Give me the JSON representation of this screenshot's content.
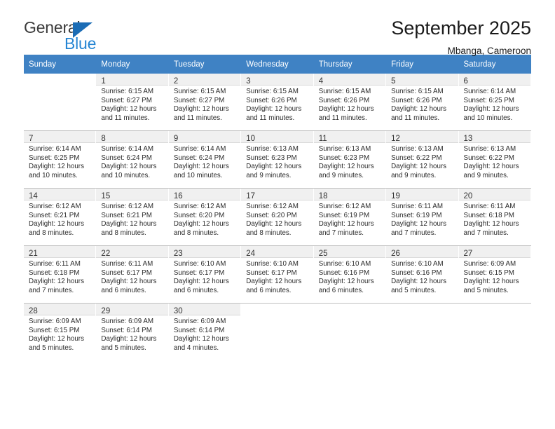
{
  "brand": {
    "name_part1": "General",
    "name_part2": "Blue",
    "accent_color": "#2585d3",
    "triangle_color": "#1b6cb5"
  },
  "header": {
    "title": "September 2025",
    "location": "Mbanga, Cameroon"
  },
  "calendar": {
    "header_bg": "#3f82c4",
    "weekday_headers": [
      "Sunday",
      "Monday",
      "Tuesday",
      "Wednesday",
      "Thursday",
      "Friday",
      "Saturday"
    ],
    "weeks": [
      [
        {
          "day": "",
          "sunrise": "",
          "sunset": "",
          "daylight1": "",
          "daylight2": ""
        },
        {
          "day": "1",
          "sunrise": "Sunrise: 6:15 AM",
          "sunset": "Sunset: 6:27 PM",
          "daylight1": "Daylight: 12 hours",
          "daylight2": "and 11 minutes."
        },
        {
          "day": "2",
          "sunrise": "Sunrise: 6:15 AM",
          "sunset": "Sunset: 6:27 PM",
          "daylight1": "Daylight: 12 hours",
          "daylight2": "and 11 minutes."
        },
        {
          "day": "3",
          "sunrise": "Sunrise: 6:15 AM",
          "sunset": "Sunset: 6:26 PM",
          "daylight1": "Daylight: 12 hours",
          "daylight2": "and 11 minutes."
        },
        {
          "day": "4",
          "sunrise": "Sunrise: 6:15 AM",
          "sunset": "Sunset: 6:26 PM",
          "daylight1": "Daylight: 12 hours",
          "daylight2": "and 11 minutes."
        },
        {
          "day": "5",
          "sunrise": "Sunrise: 6:15 AM",
          "sunset": "Sunset: 6:26 PM",
          "daylight1": "Daylight: 12 hours",
          "daylight2": "and 11 minutes."
        },
        {
          "day": "6",
          "sunrise": "Sunrise: 6:14 AM",
          "sunset": "Sunset: 6:25 PM",
          "daylight1": "Daylight: 12 hours",
          "daylight2": "and 10 minutes."
        }
      ],
      [
        {
          "day": "7",
          "sunrise": "Sunrise: 6:14 AM",
          "sunset": "Sunset: 6:25 PM",
          "daylight1": "Daylight: 12 hours",
          "daylight2": "and 10 minutes."
        },
        {
          "day": "8",
          "sunrise": "Sunrise: 6:14 AM",
          "sunset": "Sunset: 6:24 PM",
          "daylight1": "Daylight: 12 hours",
          "daylight2": "and 10 minutes."
        },
        {
          "day": "9",
          "sunrise": "Sunrise: 6:14 AM",
          "sunset": "Sunset: 6:24 PM",
          "daylight1": "Daylight: 12 hours",
          "daylight2": "and 10 minutes."
        },
        {
          "day": "10",
          "sunrise": "Sunrise: 6:13 AM",
          "sunset": "Sunset: 6:23 PM",
          "daylight1": "Daylight: 12 hours",
          "daylight2": "and 9 minutes."
        },
        {
          "day": "11",
          "sunrise": "Sunrise: 6:13 AM",
          "sunset": "Sunset: 6:23 PM",
          "daylight1": "Daylight: 12 hours",
          "daylight2": "and 9 minutes."
        },
        {
          "day": "12",
          "sunrise": "Sunrise: 6:13 AM",
          "sunset": "Sunset: 6:22 PM",
          "daylight1": "Daylight: 12 hours",
          "daylight2": "and 9 minutes."
        },
        {
          "day": "13",
          "sunrise": "Sunrise: 6:13 AM",
          "sunset": "Sunset: 6:22 PM",
          "daylight1": "Daylight: 12 hours",
          "daylight2": "and 9 minutes."
        }
      ],
      [
        {
          "day": "14",
          "sunrise": "Sunrise: 6:12 AM",
          "sunset": "Sunset: 6:21 PM",
          "daylight1": "Daylight: 12 hours",
          "daylight2": "and 8 minutes."
        },
        {
          "day": "15",
          "sunrise": "Sunrise: 6:12 AM",
          "sunset": "Sunset: 6:21 PM",
          "daylight1": "Daylight: 12 hours",
          "daylight2": "and 8 minutes."
        },
        {
          "day": "16",
          "sunrise": "Sunrise: 6:12 AM",
          "sunset": "Sunset: 6:20 PM",
          "daylight1": "Daylight: 12 hours",
          "daylight2": "and 8 minutes."
        },
        {
          "day": "17",
          "sunrise": "Sunrise: 6:12 AM",
          "sunset": "Sunset: 6:20 PM",
          "daylight1": "Daylight: 12 hours",
          "daylight2": "and 8 minutes."
        },
        {
          "day": "18",
          "sunrise": "Sunrise: 6:12 AM",
          "sunset": "Sunset: 6:19 PM",
          "daylight1": "Daylight: 12 hours",
          "daylight2": "and 7 minutes."
        },
        {
          "day": "19",
          "sunrise": "Sunrise: 6:11 AM",
          "sunset": "Sunset: 6:19 PM",
          "daylight1": "Daylight: 12 hours",
          "daylight2": "and 7 minutes."
        },
        {
          "day": "20",
          "sunrise": "Sunrise: 6:11 AM",
          "sunset": "Sunset: 6:18 PM",
          "daylight1": "Daylight: 12 hours",
          "daylight2": "and 7 minutes."
        }
      ],
      [
        {
          "day": "21",
          "sunrise": "Sunrise: 6:11 AM",
          "sunset": "Sunset: 6:18 PM",
          "daylight1": "Daylight: 12 hours",
          "daylight2": "and 7 minutes."
        },
        {
          "day": "22",
          "sunrise": "Sunrise: 6:11 AM",
          "sunset": "Sunset: 6:17 PM",
          "daylight1": "Daylight: 12 hours",
          "daylight2": "and 6 minutes."
        },
        {
          "day": "23",
          "sunrise": "Sunrise: 6:10 AM",
          "sunset": "Sunset: 6:17 PM",
          "daylight1": "Daylight: 12 hours",
          "daylight2": "and 6 minutes."
        },
        {
          "day": "24",
          "sunrise": "Sunrise: 6:10 AM",
          "sunset": "Sunset: 6:17 PM",
          "daylight1": "Daylight: 12 hours",
          "daylight2": "and 6 minutes."
        },
        {
          "day": "25",
          "sunrise": "Sunrise: 6:10 AM",
          "sunset": "Sunset: 6:16 PM",
          "daylight1": "Daylight: 12 hours",
          "daylight2": "and 6 minutes."
        },
        {
          "day": "26",
          "sunrise": "Sunrise: 6:10 AM",
          "sunset": "Sunset: 6:16 PM",
          "daylight1": "Daylight: 12 hours",
          "daylight2": "and 5 minutes."
        },
        {
          "day": "27",
          "sunrise": "Sunrise: 6:09 AM",
          "sunset": "Sunset: 6:15 PM",
          "daylight1": "Daylight: 12 hours",
          "daylight2": "and 5 minutes."
        }
      ],
      [
        {
          "day": "28",
          "sunrise": "Sunrise: 6:09 AM",
          "sunset": "Sunset: 6:15 PM",
          "daylight1": "Daylight: 12 hours",
          "daylight2": "and 5 minutes."
        },
        {
          "day": "29",
          "sunrise": "Sunrise: 6:09 AM",
          "sunset": "Sunset: 6:14 PM",
          "daylight1": "Daylight: 12 hours",
          "daylight2": "and 5 minutes."
        },
        {
          "day": "30",
          "sunrise": "Sunrise: 6:09 AM",
          "sunset": "Sunset: 6:14 PM",
          "daylight1": "Daylight: 12 hours",
          "daylight2": "and 4 minutes."
        },
        {
          "day": "",
          "sunrise": "",
          "sunset": "",
          "daylight1": "",
          "daylight2": ""
        },
        {
          "day": "",
          "sunrise": "",
          "sunset": "",
          "daylight1": "",
          "daylight2": ""
        },
        {
          "day": "",
          "sunrise": "",
          "sunset": "",
          "daylight1": "",
          "daylight2": ""
        },
        {
          "day": "",
          "sunrise": "",
          "sunset": "",
          "daylight1": "",
          "daylight2": ""
        }
      ]
    ]
  }
}
